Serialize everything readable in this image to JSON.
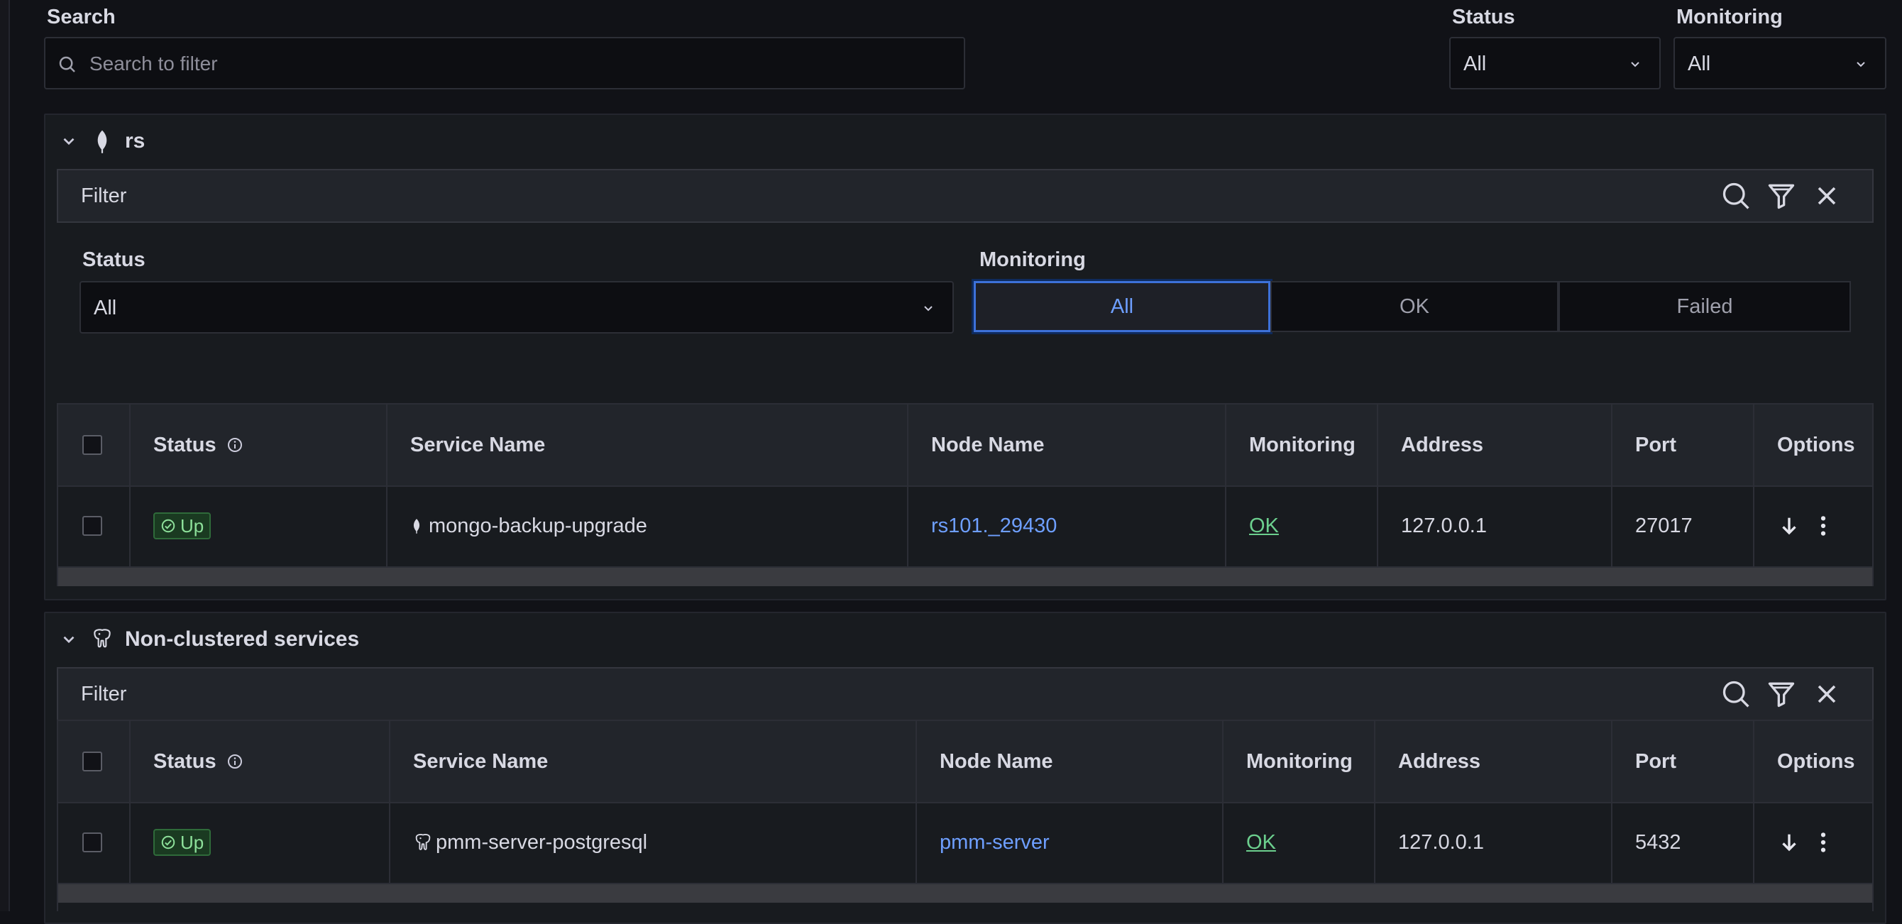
{
  "search": {
    "label": "Search",
    "placeholder": "Search to filter"
  },
  "top_filters": {
    "status": {
      "label": "Status",
      "value": "All"
    },
    "monitoring": {
      "label": "Monitoring",
      "value": "All"
    }
  },
  "groups": [
    {
      "title": "rs",
      "icon": "mongodb-leaf-icon",
      "filter_label": "Filter",
      "status_filter": {
        "label": "Status",
        "value": "All"
      },
      "monitoring_filter": {
        "label": "Monitoring",
        "options": [
          "All",
          "OK",
          "Failed"
        ],
        "selected": "All"
      },
      "columns": [
        "Status",
        "Service Name",
        "Node Name",
        "Monitoring",
        "Address",
        "Port",
        "Options"
      ],
      "rows": [
        {
          "status": "Up",
          "service_name": "mongo-backup-upgrade",
          "node_name": "rs101._29430",
          "monitoring": "OK",
          "address": "127.0.0.1",
          "port": "27017"
        }
      ]
    },
    {
      "title": "Non-clustered services",
      "icon": "postgresql-elephant-icon",
      "filter_label": "Filter",
      "columns": [
        "Status",
        "Service Name",
        "Node Name",
        "Monitoring",
        "Address",
        "Port",
        "Options"
      ],
      "rows": [
        {
          "status": "Up",
          "service_name": "pmm-server-postgresql",
          "node_name": "pmm-server",
          "monitoring": "OK",
          "address": "127.0.0.1",
          "port": "5432"
        }
      ]
    }
  ],
  "colors": {
    "accent": "#6e9fff",
    "ok": "#6ccf8e",
    "up_badge": "#1a3a21"
  }
}
